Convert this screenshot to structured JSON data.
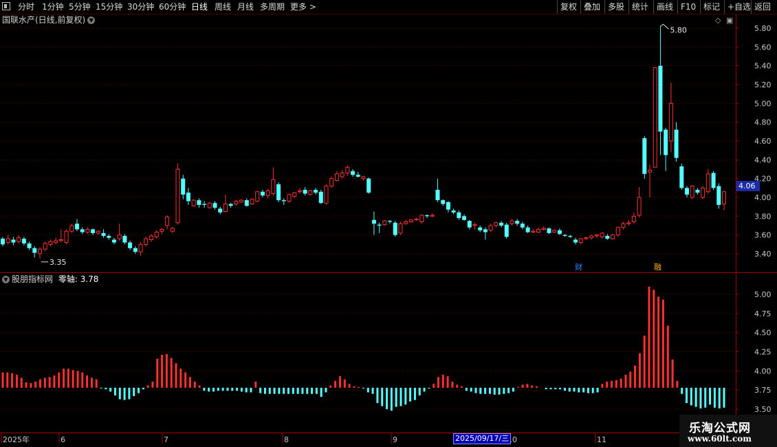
{
  "toolbar": {
    "periods": [
      "分时",
      "1分钟",
      "5分钟",
      "15分钟",
      "30分钟",
      "60分钟",
      "日线",
      "周线",
      "月线",
      "多周期",
      "更多 >"
    ],
    "active_period": "日线",
    "actions": [
      "复权",
      "叠加",
      "多股",
      "统计",
      "画线",
      "F10",
      "标记",
      "+自选",
      "返回"
    ]
  },
  "stock": {
    "title": "国联水产(日线,前复权)",
    "current_price": "4.06",
    "high_label": "5.80",
    "low_label": "3.35",
    "event_tags": [
      "财",
      "融"
    ]
  },
  "indicator": {
    "name": "股朋指标网",
    "zero_axis_label": "零轴: 3.78"
  },
  "time_axis": {
    "labels": [
      "2025年",
      "6",
      "7",
      "8",
      "9",
      "10",
      "11"
    ],
    "cursor_date": "2025/09/17/三"
  },
  "watermark": {
    "line1": "乐淘公式网",
    "line2": "www.60lt.com"
  },
  "colors": {
    "up": "#ff3030",
    "down": "#54ffff",
    "grid": "#6a0000",
    "axis_text": "#c8c8c8",
    "price_tag": "#1a2aa8"
  },
  "chart_data": [
    {
      "type": "candlestick",
      "title": "国联水产(日线,前复权)",
      "ylim": [
        3.3,
        5.85
      ],
      "y_ticks": [
        3.4,
        3.6,
        3.8,
        4.0,
        4.2,
        4.4,
        4.6,
        4.8,
        5.0,
        5.2,
        5.4,
        5.6,
        5.8
      ],
      "candles": [
        [
          3.56,
          3.5,
          3.58,
          3.48
        ],
        [
          3.52,
          3.56,
          3.6,
          3.5
        ],
        [
          3.55,
          3.52,
          3.58,
          3.49
        ],
        [
          3.53,
          3.57,
          3.6,
          3.51
        ],
        [
          3.56,
          3.51,
          3.58,
          3.49
        ],
        [
          3.51,
          3.46,
          3.53,
          3.44
        ],
        [
          3.46,
          3.41,
          3.48,
          3.36
        ],
        [
          3.4,
          3.45,
          3.47,
          3.35
        ],
        [
          3.45,
          3.51,
          3.53,
          3.43
        ],
        [
          3.5,
          3.53,
          3.55,
          3.48
        ],
        [
          3.52,
          3.54,
          3.57,
          3.5
        ],
        [
          3.54,
          3.55,
          3.66,
          3.52
        ],
        [
          3.52,
          3.64,
          3.66,
          3.5
        ],
        [
          3.64,
          3.7,
          3.72,
          3.62
        ],
        [
          3.72,
          3.66,
          3.77,
          3.64
        ],
        [
          3.66,
          3.63,
          3.68,
          3.61
        ],
        [
          3.63,
          3.66,
          3.68,
          3.61
        ],
        [
          3.66,
          3.62,
          3.67,
          3.6
        ],
        [
          3.62,
          3.64,
          3.65,
          3.6
        ],
        [
          3.62,
          3.59,
          3.66,
          3.57
        ],
        [
          3.59,
          3.57,
          3.61,
          3.55
        ],
        [
          3.55,
          3.52,
          3.57,
          3.5
        ],
        [
          3.56,
          3.6,
          3.72,
          3.54
        ],
        [
          3.59,
          3.52,
          3.61,
          3.5
        ],
        [
          3.52,
          3.46,
          3.54,
          3.44
        ],
        [
          3.46,
          3.42,
          3.48,
          3.4
        ],
        [
          3.42,
          3.5,
          3.52,
          3.38
        ],
        [
          3.5,
          3.56,
          3.58,
          3.48
        ],
        [
          3.55,
          3.59,
          3.61,
          3.53
        ],
        [
          3.58,
          3.63,
          3.65,
          3.56
        ],
        [
          3.64,
          3.66,
          3.67,
          3.61
        ],
        [
          3.7,
          3.79,
          3.81,
          3.66
        ],
        [
          3.64,
          3.67,
          3.69,
          3.62
        ],
        [
          3.73,
          4.3,
          4.36,
          3.71
        ],
        [
          4.2,
          4.03,
          4.24,
          3.98
        ],
        [
          4.05,
          3.96,
          4.1,
          3.92
        ],
        [
          3.91,
          3.97,
          3.98,
          3.9
        ],
        [
          3.97,
          3.92,
          3.99,
          3.89
        ],
        [
          3.93,
          3.92,
          3.96,
          3.89
        ],
        [
          3.89,
          3.94,
          3.95,
          3.88
        ],
        [
          3.94,
          3.89,
          3.96,
          3.87
        ],
        [
          3.88,
          3.84,
          3.9,
          3.82
        ],
        [
          3.85,
          3.93,
          4.03,
          3.84
        ],
        [
          3.93,
          3.91,
          3.94,
          3.89
        ],
        [
          3.93,
          3.96,
          3.97,
          3.91
        ],
        [
          3.95,
          3.97,
          3.98,
          3.94
        ],
        [
          3.97,
          3.91,
          3.99,
          3.9
        ],
        [
          3.93,
          3.98,
          3.99,
          3.92
        ],
        [
          3.96,
          4.06,
          4.07,
          3.95
        ],
        [
          4.06,
          4.02,
          4.08,
          4.0
        ],
        [
          4.02,
          4.07,
          4.09,
          3.99
        ],
        [
          4.04,
          4.19,
          4.32,
          4.02
        ],
        [
          4.14,
          3.97,
          4.16,
          3.95
        ],
        [
          3.97,
          3.96,
          3.99,
          3.92
        ],
        [
          3.96,
          4.03,
          4.04,
          3.94
        ],
        [
          4.01,
          4.05,
          4.06,
          3.99
        ],
        [
          4.06,
          4.07,
          4.1,
          4.04
        ],
        [
          4.08,
          4.04,
          4.11,
          4.02
        ],
        [
          4.03,
          4.07,
          4.08,
          4.02
        ],
        [
          4.08,
          4.05,
          4.1,
          4.03
        ],
        [
          4.06,
          3.94,
          4.08,
          3.93
        ],
        [
          3.94,
          4.12,
          4.14,
          3.92
        ],
        [
          4.12,
          4.2,
          4.22,
          4.1
        ],
        [
          4.18,
          4.25,
          4.28,
          4.17
        ],
        [
          4.22,
          4.26,
          4.29,
          4.2
        ],
        [
          4.26,
          4.32,
          4.34,
          4.23
        ],
        [
          4.28,
          4.24,
          4.3,
          4.22
        ],
        [
          4.24,
          4.22,
          4.27,
          4.21
        ],
        [
          4.2,
          4.22,
          4.23,
          4.18
        ],
        [
          4.2,
          4.05,
          4.21,
          4.04
        ],
        [
          3.76,
          3.72,
          3.85,
          3.6
        ],
        [
          3.71,
          3.7,
          3.73,
          3.62
        ],
        [
          3.71,
          3.75,
          3.76,
          3.7
        ],
        [
          3.75,
          3.74,
          3.76,
          3.72
        ],
        [
          3.73,
          3.6,
          3.75,
          3.58
        ],
        [
          3.62,
          3.72,
          3.74,
          3.6
        ],
        [
          3.72,
          3.74,
          3.76,
          3.71
        ],
        [
          3.74,
          3.76,
          3.77,
          3.73
        ],
        [
          3.76,
          3.77,
          3.78,
          3.75
        ],
        [
          3.74,
          3.81,
          3.82,
          3.72
        ],
        [
          3.81,
          3.8,
          3.82,
          3.78
        ],
        [
          3.8,
          3.81,
          3.83,
          3.79
        ],
        [
          4.08,
          3.97,
          4.2,
          3.95
        ],
        [
          3.97,
          3.93,
          3.98,
          3.91
        ],
        [
          3.95,
          3.87,
          3.96,
          3.84
        ],
        [
          3.86,
          3.84,
          3.88,
          3.82
        ],
        [
          3.84,
          3.78,
          3.86,
          3.76
        ],
        [
          3.8,
          3.76,
          3.82,
          3.75
        ],
        [
          3.75,
          3.68,
          3.76,
          3.66
        ],
        [
          3.7,
          3.71,
          3.73,
          3.66
        ],
        [
          3.68,
          3.65,
          3.7,
          3.63
        ],
        [
          3.66,
          3.63,
          3.68,
          3.55
        ],
        [
          3.65,
          3.7,
          3.72,
          3.63
        ],
        [
          3.7,
          3.73,
          3.74,
          3.68
        ],
        [
          3.73,
          3.7,
          3.75,
          3.68
        ],
        [
          3.71,
          3.58,
          3.73,
          3.56
        ],
        [
          3.72,
          3.75,
          3.77,
          3.7
        ],
        [
          3.75,
          3.72,
          3.77,
          3.7
        ],
        [
          3.72,
          3.68,
          3.74,
          3.66
        ],
        [
          3.68,
          3.63,
          3.7,
          3.62
        ],
        [
          3.63,
          3.64,
          3.66,
          3.62
        ],
        [
          3.63,
          3.66,
          3.68,
          3.62
        ],
        [
          3.66,
          3.67,
          3.69,
          3.65
        ],
        [
          3.67,
          3.62,
          3.68,
          3.61
        ],
        [
          3.63,
          3.65,
          3.66,
          3.62
        ],
        [
          3.65,
          3.61,
          3.67,
          3.6
        ],
        [
          3.6,
          3.59,
          3.61,
          3.58
        ],
        [
          3.59,
          3.58,
          3.6,
          3.57
        ],
        [
          3.55,
          3.52,
          3.57,
          3.5
        ],
        [
          3.52,
          3.56,
          3.57,
          3.5
        ],
        [
          3.56,
          3.57,
          3.58,
          3.55
        ],
        [
          3.57,
          3.59,
          3.6,
          3.55
        ],
        [
          3.59,
          3.6,
          3.61,
          3.57
        ],
        [
          3.58,
          3.62,
          3.63,
          3.56
        ],
        [
          3.59,
          3.56,
          3.61,
          3.55
        ],
        [
          3.56,
          3.6,
          3.61,
          3.55
        ],
        [
          3.6,
          3.68,
          3.69,
          3.58
        ],
        [
          3.68,
          3.72,
          3.74,
          3.66
        ],
        [
          3.72,
          3.73,
          3.76,
          3.7
        ],
        [
          3.74,
          3.8,
          3.84,
          3.72
        ],
        [
          3.81,
          4.0,
          4.11,
          3.79
        ],
        [
          4.63,
          4.25,
          4.65,
          4.2
        ],
        [
          4.27,
          4.29,
          4.35,
          4.0
        ],
        [
          4.32,
          5.38,
          5.38,
          4.6
        ],
        [
          5.4,
          4.7,
          5.82,
          4.45
        ],
        [
          4.72,
          4.45,
          4.74,
          4.28
        ],
        [
          4.6,
          5.0,
          5.22,
          4.48
        ],
        [
          4.72,
          4.42,
          4.8,
          4.38
        ],
        [
          4.33,
          4.1,
          4.36,
          4.08
        ],
        [
          4.1,
          4.03,
          4.12,
          4.0
        ],
        [
          4.0,
          4.12,
          4.13,
          3.98
        ],
        [
          4.08,
          4.05,
          4.1,
          4.03
        ],
        [
          4.0,
          4.1,
          4.12,
          3.98
        ],
        [
          4.06,
          4.25,
          4.3,
          4.04
        ],
        [
          4.26,
          4.1,
          4.28,
          4.08
        ],
        [
          4.12,
          3.92,
          4.15,
          3.88
        ],
        [
          3.93,
          4.06,
          4.07,
          3.86
        ]
      ]
    },
    {
      "type": "bar",
      "title": "股朋指标网",
      "ylim": [
        3.5,
        5.2
      ],
      "baseline": 3.78,
      "y_ticks": [
        3.5,
        3.75,
        4.0,
        4.25,
        4.5,
        4.75,
        5.0
      ],
      "values": [
        3.98,
        3.98,
        3.97,
        3.95,
        3.91,
        3.85,
        3.84,
        3.86,
        3.89,
        3.91,
        3.92,
        3.94,
        3.98,
        4.03,
        4.03,
        4.01,
        4.0,
        3.98,
        3.94,
        3.91,
        3.89,
        3.77,
        3.76,
        3.73,
        3.68,
        3.63,
        3.62,
        3.63,
        3.67,
        3.71,
        3.76,
        3.81,
        3.86,
        4.16,
        4.21,
        4.22,
        4.17,
        4.1,
        4.03,
        3.98,
        3.92,
        3.86,
        3.81,
        3.74,
        3.73,
        3.73,
        3.74,
        3.74,
        3.74,
        3.74,
        3.74,
        3.73,
        3.72,
        3.72,
        3.86,
        3.71,
        3.7,
        3.7,
        3.7,
        3.7,
        3.7,
        3.7,
        3.7,
        3.7,
        3.7,
        3.7,
        3.7,
        3.7,
        3.66,
        3.72,
        3.81,
        3.87,
        3.93,
        3.89,
        3.83,
        3.8,
        3.79,
        3.77,
        3.72,
        3.7,
        3.58,
        3.54,
        3.5,
        3.48,
        3.53,
        3.54,
        3.56,
        3.6,
        3.62,
        3.68,
        3.73,
        3.77,
        3.83,
        3.92,
        3.95,
        3.93,
        3.86,
        3.82,
        3.8,
        3.74,
        3.73,
        3.71,
        3.7,
        3.7,
        3.7,
        3.69,
        3.69,
        3.7,
        3.71,
        3.73,
        3.79,
        3.82,
        3.83,
        3.81,
        3.8,
        3.78,
        3.76,
        3.76,
        3.76,
        3.76,
        3.74,
        3.73,
        3.73,
        3.72,
        3.72,
        3.71,
        3.71,
        3.72,
        3.83,
        3.86,
        3.87,
        3.88,
        3.9,
        3.95,
        3.99,
        4.07,
        4.23,
        4.46,
        5.1,
        5.06,
        4.97,
        4.93,
        4.59,
        4.15,
        3.87,
        3.7,
        3.58,
        3.55,
        3.53,
        3.51,
        3.52,
        3.56,
        3.52,
        3.51,
        3.52
      ]
    }
  ]
}
